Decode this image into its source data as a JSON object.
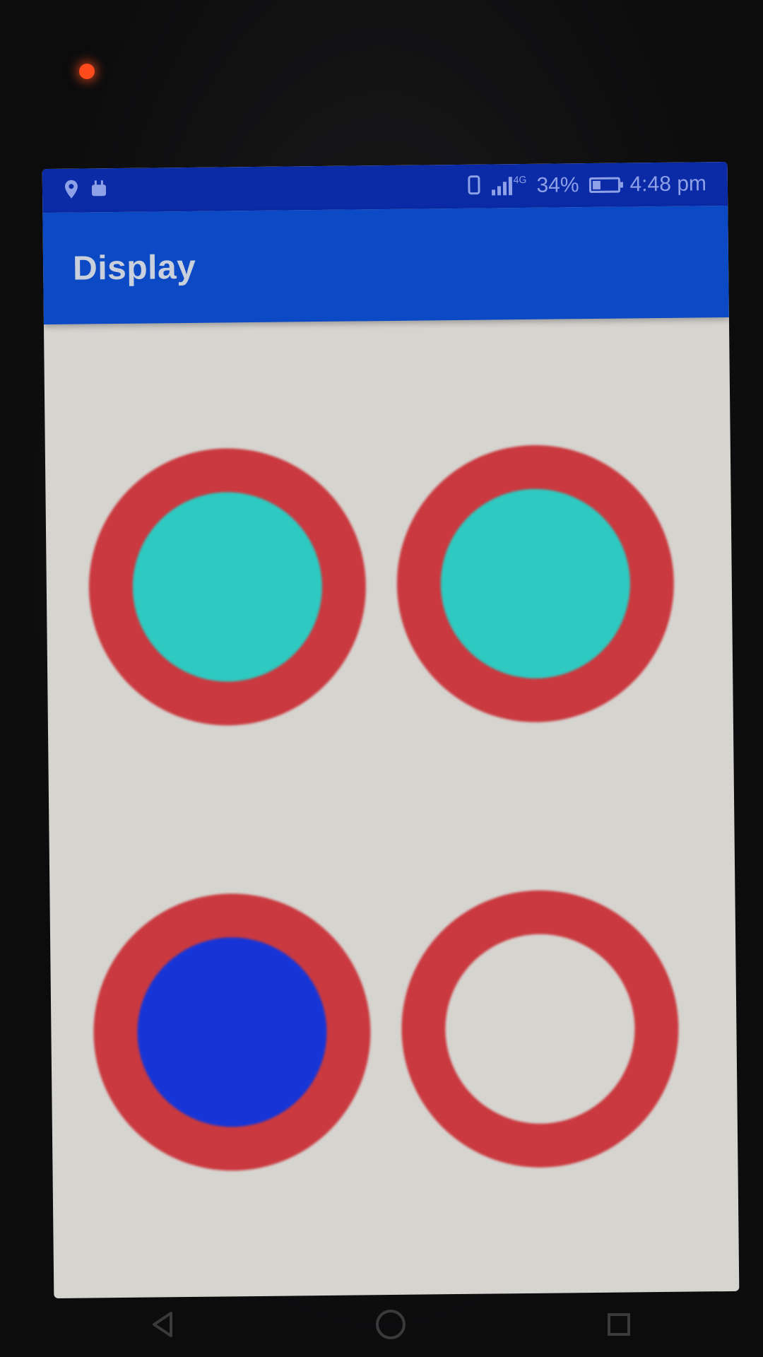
{
  "status_bar": {
    "signal_label": "4G",
    "battery_text": "34%",
    "battery_level_percent": 34,
    "time": "4:48 pm"
  },
  "app_bar": {
    "title": "Display"
  },
  "circles": [
    {
      "ring_color": "#c9393f",
      "fill_color": "#2ec9c0"
    },
    {
      "ring_color": "#c9393f",
      "fill_color": "#2ec9c0"
    },
    {
      "ring_color": "#c9393f",
      "fill_color": "#1735d6"
    },
    {
      "ring_color": "#c9393f",
      "fill_color": "#d6d4cf"
    }
  ],
  "nav": {
    "back_icon": "back-triangle-icon",
    "home_icon": "home-circle-icon",
    "recents_icon": "recents-square-icon"
  },
  "colors": {
    "status_bar": "#0a2aa6",
    "app_bar": "#0c49c4",
    "background": "#d6d4cf"
  }
}
